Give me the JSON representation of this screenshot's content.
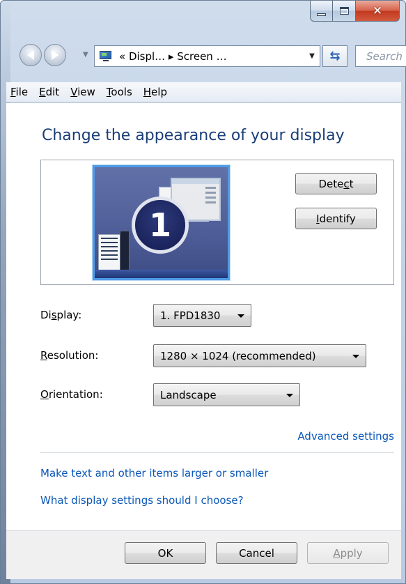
{
  "window": {
    "caption_buttons": {
      "minimize": "minimize-icon",
      "maximize": "maximize-icon",
      "close": "close-icon"
    }
  },
  "navigation": {
    "address": "« Displ… ▸ Screen …",
    "search_placeholder": "Search"
  },
  "menu": [
    {
      "pre": "",
      "key": "F",
      "post": "ile"
    },
    {
      "pre": "",
      "key": "E",
      "post": "dit"
    },
    {
      "pre": "",
      "key": "V",
      "post": "iew"
    },
    {
      "pre": "",
      "key": "T",
      "post": "ools"
    },
    {
      "pre": "",
      "key": "H",
      "post": "elp"
    }
  ],
  "content": {
    "title": "Change the appearance of your display",
    "monitor_number": "1",
    "detect": {
      "pre": "Dete",
      "key": "c",
      "post": "t"
    },
    "identify": {
      "pre": "",
      "key": "I",
      "post": "dentify"
    },
    "display": {
      "label_pre": "Di",
      "label_key": "s",
      "label_post": "play:",
      "value": "1. FPD1830"
    },
    "resolution": {
      "label_pre": "",
      "label_key": "R",
      "label_post": "esolution:",
      "value": "1280 × 1024 (recommended)"
    },
    "orientation": {
      "label_pre": "",
      "label_key": "O",
      "label_post": "rientation:",
      "value": "Landscape"
    },
    "advanced_link": "Advanced settings",
    "larger_link": "Make text and other items larger or smaller",
    "which_link": "What display settings should I choose?"
  },
  "footer": {
    "ok": "OK",
    "cancel": "Cancel",
    "apply": {
      "pre": "",
      "key": "A",
      "post": "pply"
    }
  },
  "colors": {
    "accent_title": "#1a3e78",
    "link": "#0a57b9",
    "close_red": "#c1381f"
  }
}
